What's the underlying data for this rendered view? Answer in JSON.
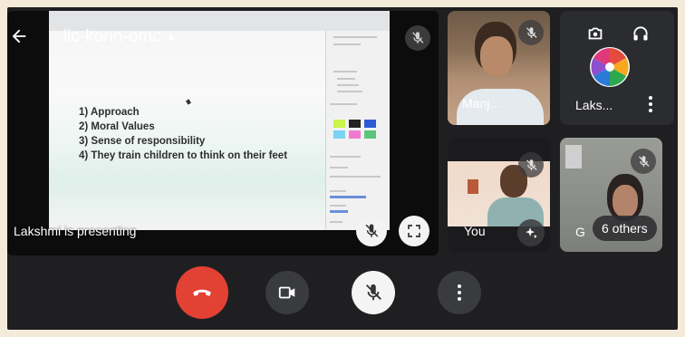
{
  "meeting": {
    "title": "iic-konn-omc",
    "presenting_label": "Lakshmi is presenting"
  },
  "slide": {
    "items": [
      "1) Approach",
      "2) Moral Values",
      "3) Sense of responsibility",
      "4) They train children to think on their feet"
    ]
  },
  "participants": [
    {
      "name": "Manj...",
      "muted": true
    },
    {
      "name": "Laks...",
      "muted": false
    },
    {
      "name": "You",
      "muted": true
    },
    {
      "name": "G",
      "muted": true
    }
  ],
  "others_label": "6 others",
  "colors": {
    "end_call": "#e34133",
    "tile_bg": "#2b2c2f",
    "frame_bg": "#1f1f21"
  },
  "icons": {
    "back": "arrow-left-icon",
    "switch_camera": "camera-switch-icon",
    "audio": "headphones-icon",
    "mic_off": "mic-off-icon",
    "fullscreen": "fullscreen-icon",
    "effects": "sparkle-icon",
    "end_call": "phone-hangup-icon",
    "camera": "video-camera-icon",
    "more": "more-vertical-icon"
  }
}
